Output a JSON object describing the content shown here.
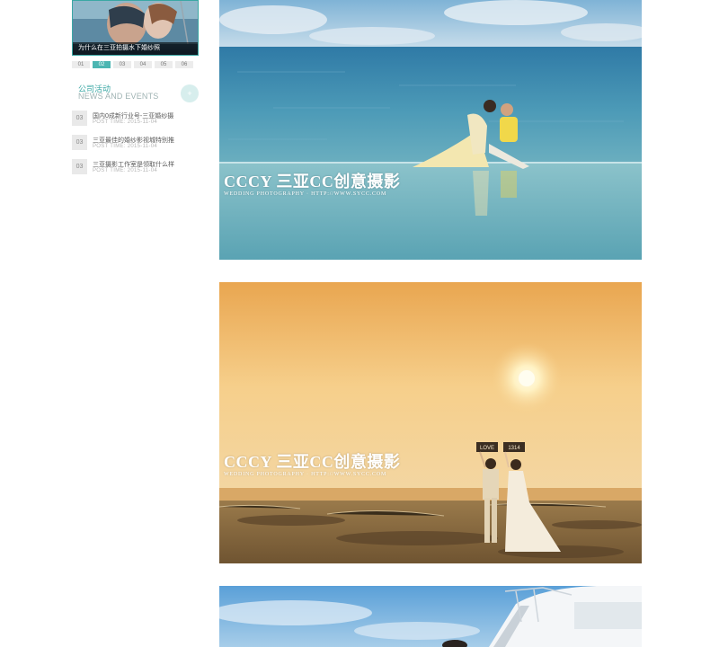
{
  "sidebar": {
    "promo": {
      "caption": "为什么在三亚拍摄水下婚纱照"
    },
    "pager": {
      "pages": [
        "01",
        "02",
        "03",
        "04",
        "05",
        "06"
      ],
      "active": "02"
    },
    "news": {
      "title_cn": "公司活动",
      "title_en": "NEWS AND EVENTS",
      "more_glyph": "+",
      "items": [
        {
          "num": "03",
          "title": "国内0成新行业号-三亚婚纱摄",
          "time": "POST TIME: 2015-11-04"
        },
        {
          "num": "03",
          "title": "三亚最佳的婚纱影视城特别推",
          "time": "POST TIME: 2015-11-04"
        },
        {
          "num": "03",
          "title": "三亚摄影工作室是领取什么样",
          "time": "POST TIME: 2015-11-04"
        }
      ]
    }
  },
  "photos": [
    {
      "brand": "CCCY 三亚CC创意摄影",
      "sub": "WEDDING PHOTOGRAPHY · HTTP://WWW.SYCC.COM"
    },
    {
      "brand": "CCCY 三亚CC创意摄影",
      "sub": "WEDDING PHOTOGRAPHY · HTTP://WWW.SYCC.COM",
      "sign_left": "LOVE",
      "sign_right": "1314"
    }
  ],
  "colors": {
    "accent": "#3aa7a4",
    "pager_active": "#4cb6b2"
  }
}
